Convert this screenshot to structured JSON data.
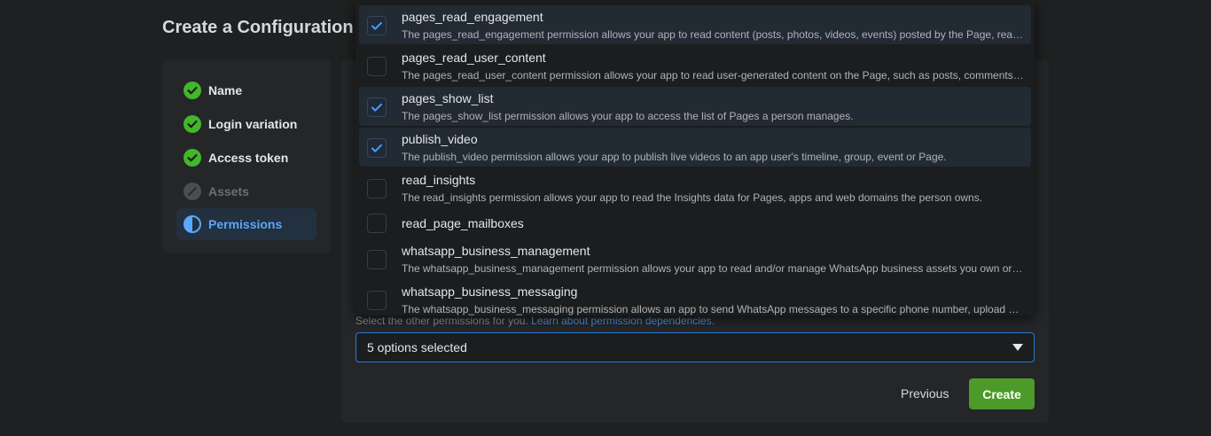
{
  "page": {
    "title": "Create a Configuration"
  },
  "steps": [
    {
      "label": "Name",
      "status": "complete",
      "icon": "check-circle-icon"
    },
    {
      "label": "Login variation",
      "status": "complete",
      "icon": "check-circle-icon"
    },
    {
      "label": "Access token",
      "status": "complete",
      "icon": "check-circle-icon"
    },
    {
      "label": "Assets",
      "status": "disabled",
      "icon": "disabled-circle-icon"
    },
    {
      "label": "Permissions",
      "status": "active",
      "icon": "half-circle-icon"
    }
  ],
  "permissions": {
    "helper_text": "Select the other permissions for you.",
    "helper_link": "Learn about permission dependencies.",
    "select_value": "5 options selected",
    "options": [
      {
        "name": "pages_read_engagement",
        "checked": true,
        "description": "The pages_read_engagement permission allows your app to read content (posts, photos, videos, events) posted by the Page, read followers data (including name, PSID), and profile picture, and read metadata and other insights about the Page."
      },
      {
        "name": "pages_read_user_content",
        "checked": false,
        "description": "The pages_read_user_content permission allows your app to read user-generated content on the Page, such as posts, comments and ratings by users or other Pages, and to delete user comments on Page posts."
      },
      {
        "name": "pages_show_list",
        "checked": true,
        "description": "The pages_show_list permission allows your app to access the list of Pages a person manages."
      },
      {
        "name": "publish_video",
        "checked": true,
        "description": "The publish_video permission allows your app to publish live videos to an app user's timeline, group, event or Page."
      },
      {
        "name": "read_insights",
        "checked": false,
        "description": "The read_insights permission allows your app to read the Insights data for Pages, apps and web domains the person owns."
      },
      {
        "name": "read_page_mailboxes",
        "checked": false,
        "description": ""
      },
      {
        "name": "whatsapp_business_management",
        "checked": false,
        "description": "The whatsapp_business_management permission allows your app to read and/or manage WhatsApp business assets you own or have been granted access to by other businesses through this permission."
      },
      {
        "name": "whatsapp_business_messaging",
        "checked": false,
        "description": "The whatsapp_business_messaging permission allows an app to send WhatsApp messages to a specific phone number, upload and retrieve media from messages, manage and get WhatsApp business profile information."
      }
    ]
  },
  "buttons": {
    "previous": "Previous",
    "create": "Create"
  },
  "colors": {
    "accent": "#2d7bd6",
    "success": "#4c9a2a",
    "check": "#42b72a",
    "active_text": "#5aa7ff"
  }
}
